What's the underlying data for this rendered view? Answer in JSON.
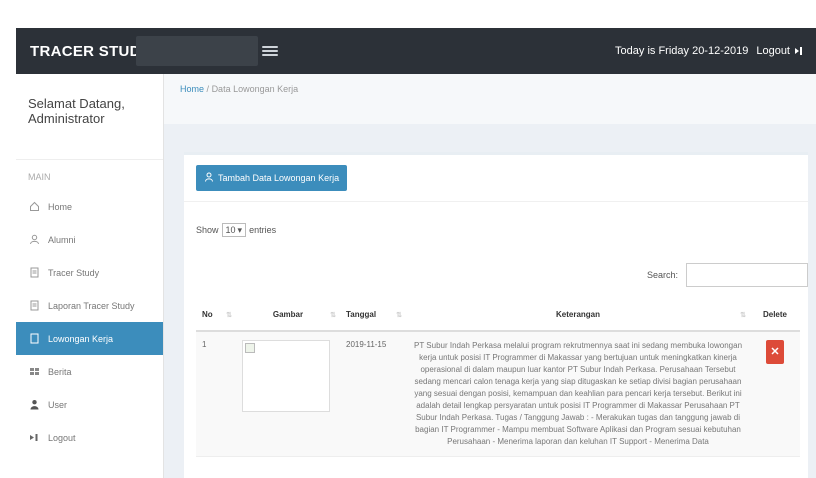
{
  "topbar": {
    "app_title": "TRACER STUDY",
    "date_text": "Today is Friday 20-12-2019",
    "logout_label": "Logout"
  },
  "sidebar": {
    "welcome_line1": "Selamat Datang,",
    "welcome_line2": "Administrator",
    "nav_header": "MAIN",
    "items": [
      {
        "label": "Home",
        "icon": "home-icon"
      },
      {
        "label": "Alumni",
        "icon": "user-icon"
      },
      {
        "label": "Tracer Study",
        "icon": "file-icon"
      },
      {
        "label": "Laporan Tracer Study",
        "icon": "file-icon"
      },
      {
        "label": "Lowongan Kerja",
        "icon": "file-icon"
      },
      {
        "label": "Berita",
        "icon": "grid-icon"
      },
      {
        "label": "User",
        "icon": "person-icon"
      },
      {
        "label": "Logout",
        "icon": "logout-icon"
      }
    ],
    "active_index": 4
  },
  "breadcrumb": {
    "home": "Home",
    "separator": "/",
    "current": "Data Lowongan Kerja"
  },
  "box": {
    "add_button_label": "Tambah Data Lowongan Kerja",
    "show_label": "Show",
    "entries_value": "10",
    "entries_label": "entries",
    "search_label": "Search:",
    "search_value": "",
    "columns": [
      "No",
      "Gambar",
      "Tanggal",
      "Keterangan",
      "Delete"
    ],
    "rows": [
      {
        "no": "1",
        "tanggal": "2019-11-15",
        "keterangan": "PT Subur Indah Perkasa melalui program rekrutmennya saat ini sedang membuka lowongan kerja untuk posisi IT Programmer di Makassar yang bertujuan untuk meningkatkan kinerja operasional di dalam maupun luar kantor PT Subur Indah Perkasa. Perusahaan Tersebut sedang mencari calon tenaga kerja yang siap ditugaskan ke setiap divisi bagian perusahaan yang sesuai dengan posisi, kemampuan dan keahlian para pencari kerja tersebut. Berikut ini adalah detail lengkap persyaratan untuk posisi IT Programmer di Makassar Perusahaan PT Subur Indah Perkasa. Tugas / Tanggung Jawab : - Merakukan tugas dan tanggung jawab di bagian IT Programmer - Mampu membuat Software Aplikasi dan Program sesuai kebutuhan Perusahaan - Menerima laporan dan keluhan IT Support - Menerima Data"
      }
    ]
  },
  "colors": {
    "topbar_bg": "#2c3138",
    "accent": "#3c8dbc",
    "danger": "#dd4b39"
  }
}
